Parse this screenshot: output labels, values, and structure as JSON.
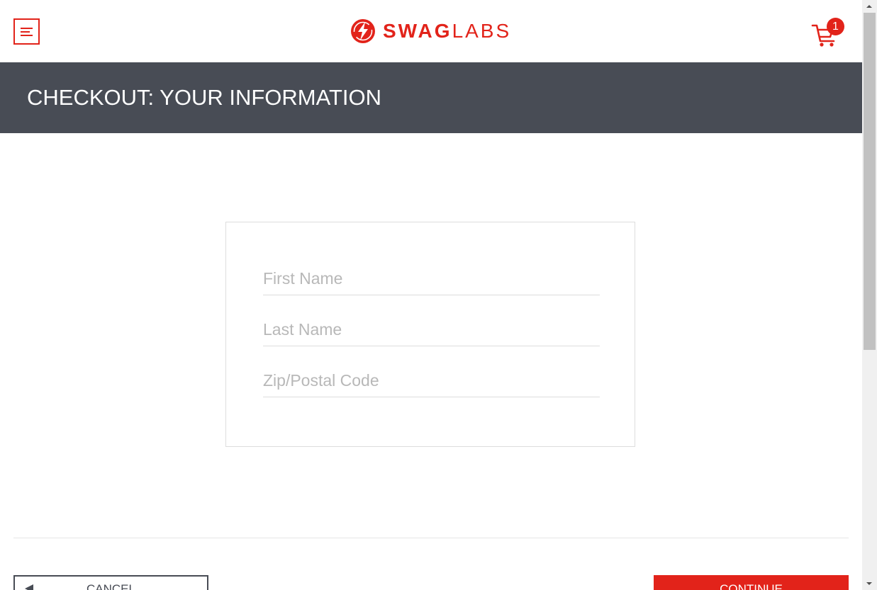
{
  "header": {
    "logo_text_bold": "SWAG",
    "logo_text_light": "LABS",
    "cart_count": "1",
    "icons": {
      "menu": "menu-icon",
      "logo": "lightning-bolt-icon",
      "cart": "cart-icon"
    }
  },
  "title_bar": {
    "title": "CHECKOUT: YOUR INFORMATION"
  },
  "form": {
    "first_name_placeholder": "First Name",
    "last_name_placeholder": "Last Name",
    "zip_placeholder": "Zip/Postal Code",
    "first_name_value": "",
    "last_name_value": "",
    "zip_value": ""
  },
  "footer": {
    "cancel_label": "CANCEL",
    "continue_label": "CONTINUE"
  },
  "colors": {
    "brand_red": "#e2231a",
    "title_bar_bg": "#484c55",
    "text_dark": "#484c55",
    "placeholder": "#b8b8b8"
  }
}
